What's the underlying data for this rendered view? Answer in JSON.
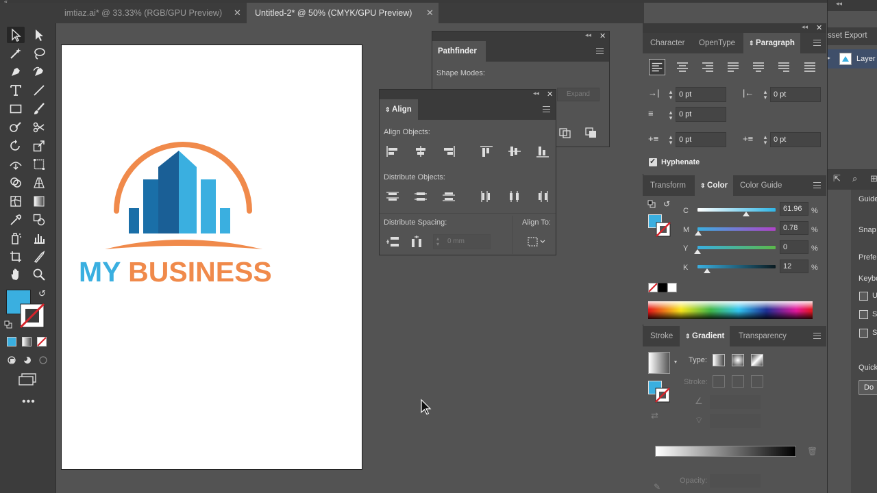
{
  "tabs": [
    {
      "label": "imtiaz.ai* @ 33.33% (RGB/GPU Preview)",
      "active": false
    },
    {
      "label": "Untitled-2* @ 50% (CMYK/GPU Preview)",
      "active": true
    }
  ],
  "logo": {
    "word1": "MY",
    "word2": "BUSINESS",
    "blue": "#3aafe0",
    "orange": "#f08a4b"
  },
  "colors": {
    "fill": "#3aafe0",
    "panel_bg": "#535353",
    "dark_bg": "#3c3c3c"
  },
  "pathfinder": {
    "title": "Pathfinder",
    "shape_modes_label": "Shape Modes:",
    "expand_label": "Expand"
  },
  "align": {
    "title": "Align",
    "objects_label": "Align Objects:",
    "distribute_label": "Distribute Objects:",
    "spacing_label": "Distribute Spacing:",
    "align_to_label": "Align To:",
    "spacing_value": "0 mm"
  },
  "character_panel": {
    "tabs": [
      "Character",
      "OpenType",
      "Paragraph"
    ],
    "active_tab": "Paragraph",
    "left_indent": "0 pt",
    "right_indent": "0 pt",
    "first_line_indent": "0 pt",
    "space_before": "0 pt",
    "space_after": "0 pt",
    "hyphenate_label": "Hyphenate",
    "hyphenate_checked": true
  },
  "color_panel": {
    "tabs": [
      "Transform",
      "Color",
      "Color Guide"
    ],
    "active_tab": "Color",
    "channels": [
      {
        "label": "C",
        "value": "61.96",
        "unit": "%",
        "level": 0.6196
      },
      {
        "label": "M",
        "value": "0.78",
        "unit": "%",
        "level": 0.0078
      },
      {
        "label": "Y",
        "value": "0",
        "unit": "%",
        "level": 0
      },
      {
        "label": "K",
        "value": "12",
        "unit": "%",
        "level": 0.12
      }
    ]
  },
  "gradient_panel": {
    "tabs": [
      "Stroke",
      "Gradient",
      "Transparency"
    ],
    "active_tab": "Gradient",
    "type_label": "Type:",
    "stroke_label": "Stroke:",
    "opacity_label": "Opacity:"
  },
  "layers_panel": {
    "tab": "sset Export",
    "layer_name": "Layer"
  },
  "properties_panel": {
    "labels": [
      "Guide",
      "Snap",
      "Prefe",
      "Keybo",
      "Quick"
    ],
    "checkbox_labels": [
      "U",
      "S",
      "S"
    ],
    "button_label": "Do"
  }
}
